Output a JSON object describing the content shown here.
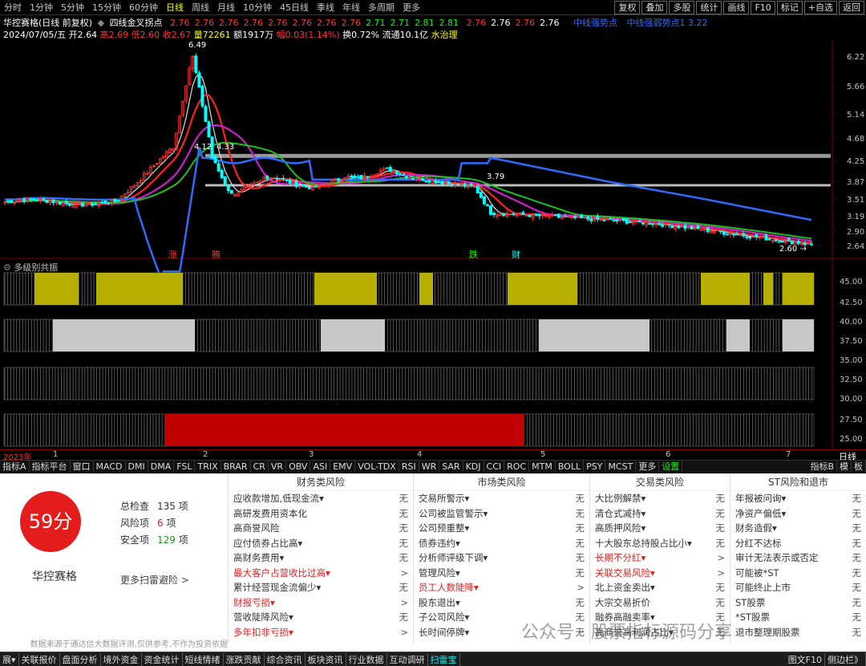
{
  "periods": [
    "分时",
    "1分钟",
    "5分钟",
    "15分钟",
    "60分钟",
    "日线",
    "周线",
    "月线",
    "10分钟",
    "45日线",
    "季线",
    "年线",
    "多周期",
    "更多"
  ],
  "active_period": "日线",
  "right_buttons": [
    "复权",
    "叠加",
    "多股",
    "统计",
    "画线",
    "F10",
    "标记",
    "+自选",
    "返回"
  ],
  "stock": {
    "name": "华控赛格",
    "mode": "(日线 前复权)",
    "indicator": "四线金叉拐点"
  },
  "price_seq1": [
    "2.76",
    "2.76",
    "2.76",
    "2.76",
    "2.76",
    "2.76",
    "2.76",
    "2.76",
    "2.71",
    "2.71",
    "2.81",
    "2.81"
  ],
  "price_seq2": [
    "2.76",
    "2.76",
    "2.76",
    "2.76"
  ],
  "legend_right": [
    "中线强势点",
    "中线强弱势点1",
    "3.22"
  ],
  "info": {
    "date": "2024/07/05/五",
    "open": "开2.64",
    "high": "高2.69",
    "low": "低2.60",
    "close": "收2.67",
    "vol": "量72261",
    "amount": "额1917万",
    "change": "幅0.03(1.14%)",
    "turnover": "换0.72%",
    "float": "流通10.1亿",
    "sector": "水治理"
  },
  "yaxis_main": [
    "6.22",
    "5.66",
    "5.14",
    "4.68",
    "4.25",
    "3.87",
    "3.51",
    "3.19",
    "2.90",
    "2.64"
  ],
  "chart_labels": {
    "top_high": "6.49",
    "mid1": "4.12",
    "mid2": "4.33",
    "mid3": "3.79",
    "last": "2.60"
  },
  "events": [
    "涨",
    "腾",
    "跌",
    "财"
  ],
  "sub_title": "多级别共振",
  "yaxis_sub": [
    "45.00",
    "42.50",
    "40.00",
    "37.50",
    "35.00",
    "32.50",
    "30.00",
    "27.50",
    "25.00"
  ],
  "time_labels": [
    "2023年",
    "1",
    "2",
    "3",
    "4",
    "5",
    "6",
    "7"
  ],
  "time_right": "日线",
  "tabs": [
    "指标A",
    "指标平台",
    "窗口",
    "MACD",
    "DMI",
    "DMA",
    "FSL",
    "TRIX",
    "BRAR",
    "CR",
    "VR",
    "OBV",
    "ASI",
    "EMV",
    "VOL-TDX",
    "RSI",
    "WR",
    "SAR",
    "KDJ",
    "CCI",
    "ROC",
    "MTM",
    "BOLL",
    "PSY",
    "MCST",
    "更多",
    "设置"
  ],
  "tabs_right": [
    "指标B",
    "模",
    "板"
  ],
  "score": {
    "value": "59分",
    "name": "华控赛格",
    "more": "更多扫雷避险 >",
    "total_label": "总检查",
    "total": "135",
    "total_unit": "项",
    "risk_label": "风险项",
    "risk": "6",
    "risk_unit": "项",
    "safe_label": "安全项",
    "safe": "129",
    "safe_unit": "项",
    "disclaimer": "数据来源于通达信大数据评测,仅供参考,不作为投资依据"
  },
  "columns": [
    {
      "title": "财务类风险",
      "items": [
        [
          "应收款增加,低现金流▾",
          "无"
        ],
        [
          "高研发费用资本化",
          "无"
        ],
        [
          "高商誉风险",
          "无"
        ],
        [
          "应付债券占比高▾",
          "无"
        ],
        [
          "高财务费用▾",
          "无"
        ],
        [
          "最大客户占营收比过高▾",
          ">"
        ],
        [
          "累计经营现金流偏少▾",
          "无"
        ],
        [
          "财报亏损▾",
          ">"
        ],
        [
          "营收陡降风险▾",
          "无"
        ],
        [
          "多年扣非亏损▾",
          ">"
        ]
      ],
      "red": [
        5,
        7,
        9
      ]
    },
    {
      "title": "市场类风险",
      "items": [
        [
          "交易所警示▾",
          "无"
        ],
        [
          "公司被监管警示▾",
          "无"
        ],
        [
          "公司预重整▾",
          "无"
        ],
        [
          "债券违约▾",
          "无"
        ],
        [
          "分析师评级下调▾",
          "无"
        ],
        [
          "管理风险▾",
          "无"
        ],
        [
          "员工人数陡降▾",
          ">"
        ],
        [
          "股东退出▾",
          "无"
        ],
        [
          "子公司风险▾",
          "无"
        ],
        [
          "长时间停牌▾",
          "无"
        ]
      ],
      "red": [
        6
      ]
    },
    {
      "title": "交易类风险",
      "items": [
        [
          "大比例解禁▾",
          "无"
        ],
        [
          "清仓式减持▾",
          "无"
        ],
        [
          "高质押风险▾",
          "无"
        ],
        [
          "十大股东总持股占比小▾",
          "无"
        ],
        [
          "长期不分红▾",
          ">"
        ],
        [
          "关联交易风险▾",
          ">"
        ],
        [
          "北上资金卖出▾",
          "无"
        ],
        [
          "大宗交易折价",
          "无"
        ],
        [
          "融券高融卖率▾",
          "无"
        ],
        [
          "高商誉高利润占比▾",
          "无"
        ]
      ],
      "red": [
        4,
        5
      ]
    },
    {
      "title": "ST风险和退市",
      "items": [
        [
          "年报被问询▾",
          "无"
        ],
        [
          "净资产偏低▾",
          "无"
        ],
        [
          "财务造假▾",
          "无"
        ],
        [
          "分红不达标",
          "无"
        ],
        [
          "审计无法表示或否定",
          "无"
        ],
        [
          "可能被*ST",
          "无"
        ],
        [
          "可能终止上市",
          "无"
        ],
        [
          "ST股票",
          "无"
        ],
        [
          "*ST股票",
          "无"
        ],
        [
          "退市整理期股票",
          "无"
        ]
      ],
      "red": []
    }
  ],
  "statusbar": [
    "展▾",
    "关联报价",
    "盘面分析",
    "境外资金",
    "资金统计",
    "短线情绪",
    "涨跌贡献",
    "综合资讯",
    "板块资讯",
    "行业数据",
    "互动调研",
    "扫雷宝"
  ],
  "statusbar_right": [
    "图文F10",
    "侧边栏》"
  ],
  "watermark": "公众号 · 股票指标源码分享",
  "colors": {
    "up": "#ff3232",
    "down": "#00ffff",
    "ma_white": "#dddddd",
    "ma_red": "#ff2020",
    "ma_magenta": "#d01fd0",
    "ma_green": "#20c020",
    "line_blue": "#2f6bff",
    "yellow": "#b8b000",
    "gray": "#c8c8c8",
    "darkred": "#c00000"
  }
}
